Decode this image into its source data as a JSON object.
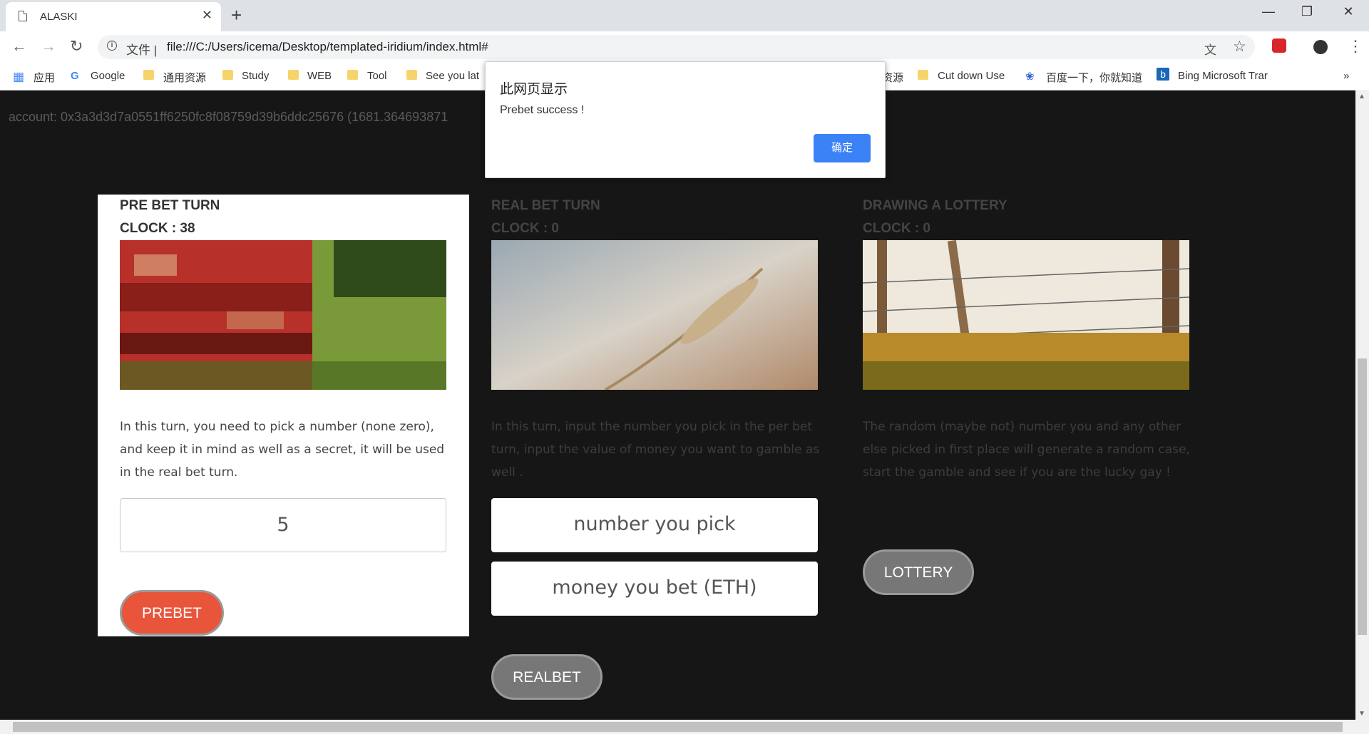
{
  "browser": {
    "tab_title": "ALASKI",
    "tab_close": "✕",
    "new_tab": "+",
    "file_label": "文件 |",
    "url": "file:///C:/Users/icema/Desktop/templated-iridium/index.html#",
    "bookmarks": [
      "应用",
      "Google",
      "通用资源",
      "Study",
      "WEB",
      "Tool",
      "See you lat",
      "资源",
      "Cut down Use",
      "百度一下，你就知道",
      "Bing Microsoft Trar"
    ],
    "bookmarks_more": "»"
  },
  "page": {
    "account": "account: 0x3a3d3d7a0551ff6250fc8f08759d39b6ddc25676 (1681.364693871",
    "cards": [
      {
        "title": "PRE BET TURN",
        "clock": "CLOCK : 38",
        "description": "In this turn, you need to pick a number (none zero), and keep it in mind as well as a secret, it will be used in the real bet turn.",
        "input_value": "5",
        "button": "PREBET",
        "active": true
      },
      {
        "title": "REAL BET TURN",
        "clock": "CLOCK : 0",
        "description": "In this turn, input the number you pick in the per bet turn, input the value of money you want to gamble as well .",
        "input_placeholder_1": "number you pick",
        "input_placeholder_2": "money you bet (ETH)",
        "button": "REALBET",
        "active": false
      },
      {
        "title": "DRAWING A LOTTERY",
        "clock": "CLOCK : 0",
        "description": "The random (maybe not) number you and any other else picked in first place will generate a random case, start the gamble and see if you are the lucky gay !",
        "button": "LOTTERY",
        "active": false
      }
    ]
  },
  "dialog": {
    "title": "此网页显示",
    "message": "Prebet success !",
    "ok_label": "确定"
  },
  "colors": {
    "accent_orange": "#e8553a",
    "button_gray": "#777777",
    "dialog_blue": "#3b82f6"
  }
}
